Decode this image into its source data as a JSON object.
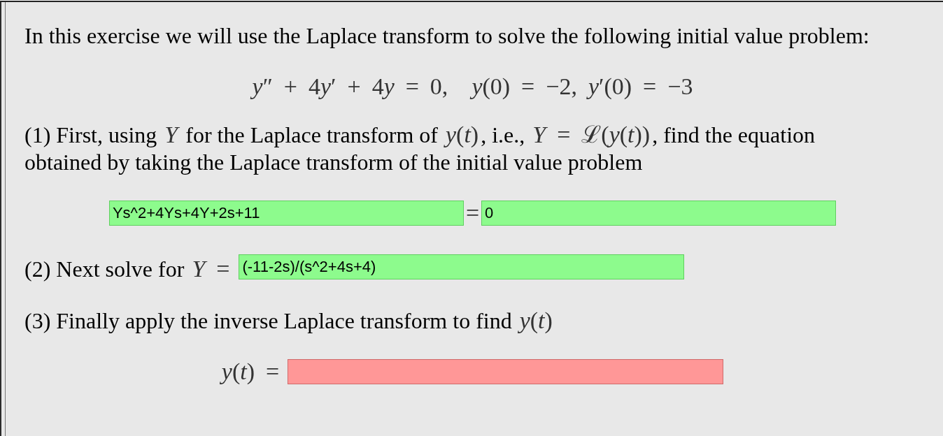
{
  "intro": "In this exercise we will use the Laplace transform to solve the following initial value problem:",
  "display_equation": {
    "equation": "y″ + 4y′ + 4y = 0,",
    "conditions": "y(0) = −2, y′(0) = −3"
  },
  "parts": [
    {
      "kind": "prompt",
      "items": [
        {
          "kind": "text",
          "segments": [
            {
              "kind": "text",
              "text": "(1) First, using "
            },
            {
              "kind": "math",
              "text": "Y"
            },
            {
              "kind": "text",
              "text": " for the Laplace transform of "
            },
            {
              "kind": "math",
              "text": "y(t)"
            },
            {
              "kind": "text",
              "text": ", i.e., "
            },
            {
              "kind": "math",
              "text": "Y = ℒ(y(t))"
            },
            {
              "kind": "text",
              "text": ", find the equation obtained by taking the Laplace transform of the initial value problem"
            }
          ]
        }
      ]
    },
    {
      "kind": "answer",
      "items": [
        {
          "kind": "field",
          "value": "Ys^2+4Ys+4Y+2s+11",
          "correct": true
        },
        {
          "kind": "math",
          "text": "="
        },
        {
          "kind": "field",
          "value": "0",
          "correct": true
        }
      ]
    },
    {
      "kind": "prompt",
      "items": [
        {
          "kind": "text",
          "segments": [
            {
              "kind": "text",
              "text": "(2) Next solve for "
            },
            {
              "kind": "math",
              "text": "Y ="
            }
          ]
        },
        {
          "kind": "field",
          "value": "(-11-2s)/(s^2+4s+4)",
          "correct": true
        }
      ]
    },
    {
      "kind": "prompt",
      "items": [
        {
          "kind": "text",
          "segments": [
            {
              "kind": "text",
              "text": "(3) Finally apply the inverse Laplace transform to find "
            },
            {
              "kind": "math",
              "text": "y(t)"
            }
          ]
        }
      ]
    },
    {
      "kind": "answer",
      "items": [
        {
          "kind": "math",
          "text": "y(t) ="
        },
        {
          "kind": "field",
          "correct": false
        }
      ]
    }
  ]
}
